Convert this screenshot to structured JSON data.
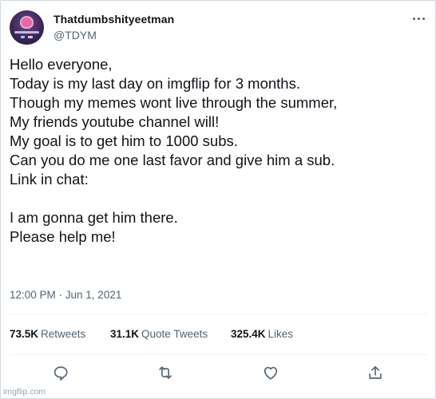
{
  "tweet": {
    "display_name": "Thatdumbshityeetman",
    "handle": "@TDYM",
    "lines": [
      "Hello everyone,",
      "Today is my last day on imgflip for 3 months.",
      "Though my memes wont live through the summer,",
      "My friends youtube channel will!",
      "My goal is to get him to 1000 subs.",
      "Can you do me one last favor and give him a sub.",
      "Link in chat:",
      "",
      "I am gonna get him there.",
      "Please help me!"
    ],
    "timestamp": "12:00 PM · Jun 1, 2021"
  },
  "stats": {
    "retweets_count": "73.5K",
    "retweets_label": "Retweets",
    "quotes_count": "31.1K",
    "quotes_label": "Quote Tweets",
    "likes_count": "325.4K",
    "likes_label": "Likes"
  },
  "actions": {
    "icons": [
      "reply-icon",
      "retweet-icon",
      "like-icon",
      "share-icon"
    ]
  },
  "watermark": "imgflip.com",
  "colors": {
    "text": "#0f1419",
    "secondary": "#536471",
    "divider": "#eff3f4",
    "border": "#cfd9de"
  }
}
